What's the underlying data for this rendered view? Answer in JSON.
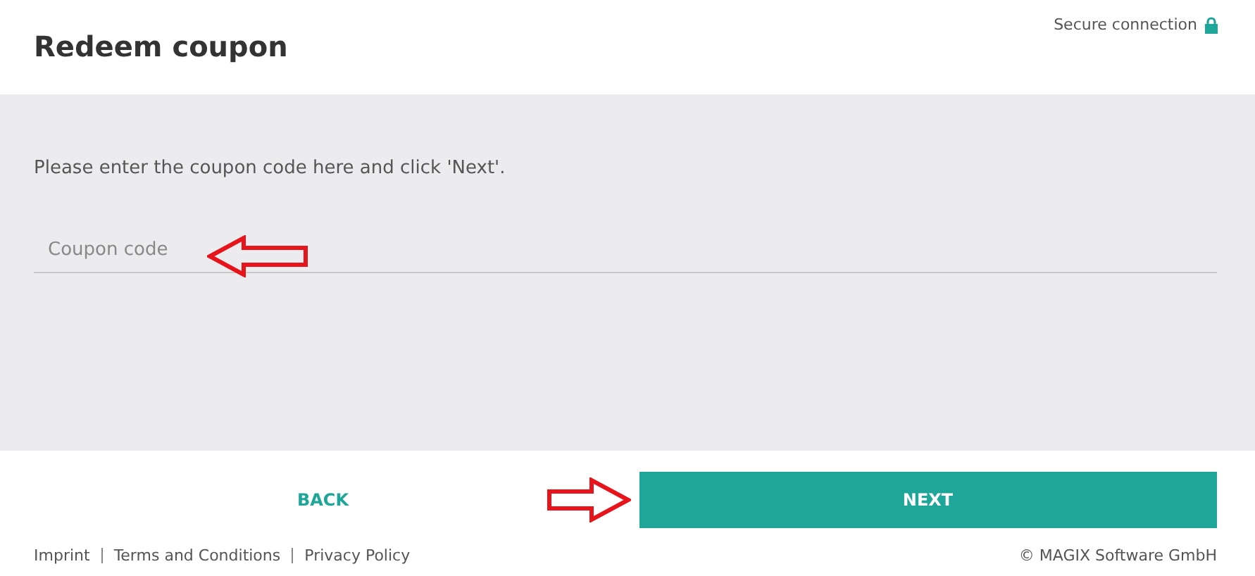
{
  "header": {
    "title": "Redeem coupon",
    "secure_label": "Secure connection"
  },
  "body": {
    "instruction": "Please enter the coupon code here and click 'Next'.",
    "coupon_field": {
      "placeholder": "Coupon code"
    }
  },
  "buttons": [
    {
      "label": "BACK",
      "kind": "link"
    },
    {
      "label": "NEXT",
      "kind": "primary"
    }
  ],
  "footer": {
    "links": [
      "Imprint",
      "Terms and Conditions",
      "Privacy Policy"
    ],
    "copyright": "© MAGIX Software GmbH"
  }
}
